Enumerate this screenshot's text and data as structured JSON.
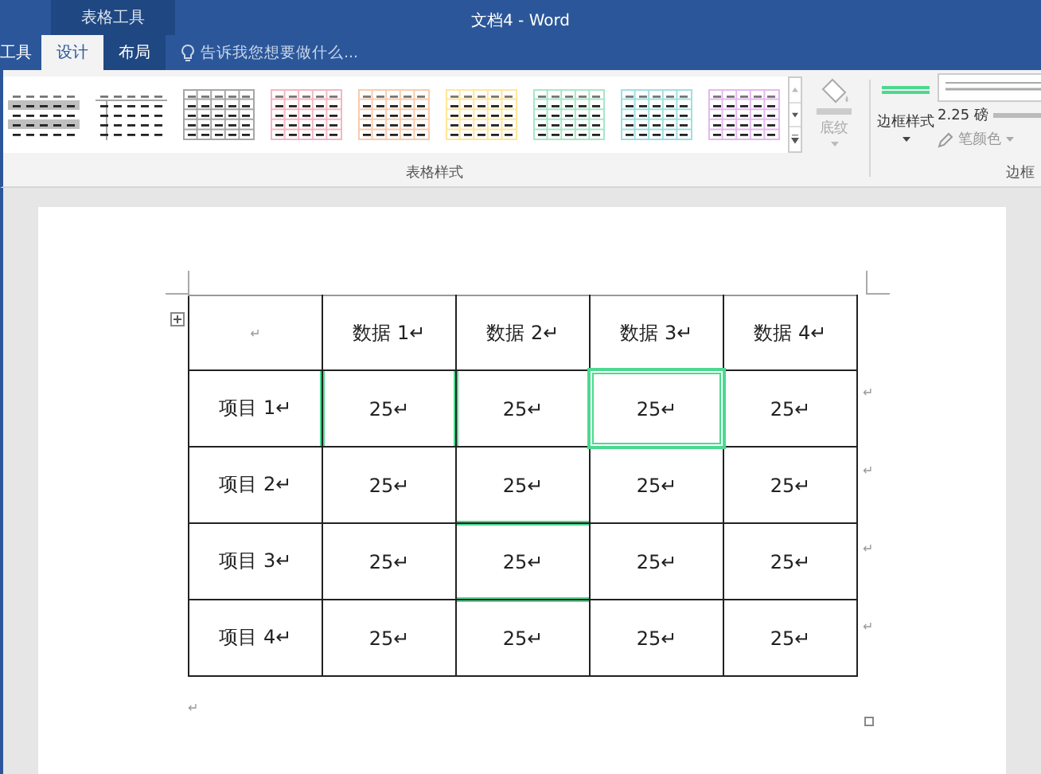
{
  "window": {
    "title": "文档4 - Word",
    "context_group": "表格工具"
  },
  "tabs": [
    {
      "label": "工具",
      "selected": false
    },
    {
      "label": "设计",
      "selected": true
    },
    {
      "label": "布局",
      "selected": false
    }
  ],
  "tell_me": {
    "placeholder": "告诉我您想要做什么..."
  },
  "table_styles": {
    "label": "表格样式",
    "styles": [
      {
        "kind": "banded",
        "color": "#bfbfbf"
      },
      {
        "kind": "lined",
        "color": "#a6a6a6"
      },
      {
        "kind": "grid",
        "color": "#a6a6a6"
      },
      {
        "kind": "grid",
        "color": "#f4b6c2"
      },
      {
        "kind": "grid",
        "color": "#f8cbad"
      },
      {
        "kind": "grid",
        "color": "#ffe699"
      },
      {
        "kind": "grid",
        "color": "#a9e5c8"
      },
      {
        "kind": "grid",
        "color": "#9fdfe0"
      },
      {
        "kind": "grid",
        "color": "#e4b8f0"
      }
    ]
  },
  "shading": {
    "label": "底纹",
    "disabled": true
  },
  "borders": {
    "label": "边框",
    "style_button": "边框样式",
    "weight": "2.25 磅",
    "pen_color": "笔颜色"
  },
  "table": {
    "rows": [
      [
        {
          "text": "↵",
          "right_border_highlighted": false,
          "bottom_border_highlighted": false,
          "selected": false
        },
        {
          "text": "数据 1↵",
          "right_border_highlighted": false,
          "bottom_border_highlighted": false,
          "selected": false
        },
        {
          "text": "数据 2↵",
          "right_border_highlighted": false,
          "bottom_border_highlighted": false,
          "selected": false
        },
        {
          "text": "数据 3↵",
          "right_border_highlighted": false,
          "bottom_border_highlighted": false,
          "selected": false
        },
        {
          "text": "数据 4↵",
          "right_border_highlighted": false,
          "bottom_border_highlighted": false,
          "selected": false
        }
      ],
      [
        {
          "text": "项目 1↵",
          "right_border_highlighted": true,
          "bottom_border_highlighted": false,
          "selected": false
        },
        {
          "text": "25↵",
          "right_border_highlighted": true,
          "bottom_border_highlighted": false,
          "selected": false
        },
        {
          "text": "25↵",
          "right_border_highlighted": false,
          "bottom_border_highlighted": false,
          "selected": false
        },
        {
          "text": "25↵",
          "right_border_highlighted": false,
          "bottom_border_highlighted": false,
          "selected": true
        },
        {
          "text": "25↵",
          "right_border_highlighted": false,
          "bottom_border_highlighted": false,
          "selected": false
        }
      ],
      [
        {
          "text": "项目 2↵",
          "right_border_highlighted": false,
          "bottom_border_highlighted": false,
          "selected": false
        },
        {
          "text": "25↵",
          "right_border_highlighted": false,
          "bottom_border_highlighted": false,
          "selected": false
        },
        {
          "text": "25↵",
          "right_border_highlighted": false,
          "bottom_border_highlighted": true,
          "selected": false
        },
        {
          "text": "25↵",
          "right_border_highlighted": false,
          "bottom_border_highlighted": false,
          "selected": false
        },
        {
          "text": "25↵",
          "right_border_highlighted": false,
          "bottom_border_highlighted": false,
          "selected": false
        }
      ],
      [
        {
          "text": "项目 3↵",
          "right_border_highlighted": false,
          "bottom_border_highlighted": false,
          "selected": false
        },
        {
          "text": "25↵",
          "right_border_highlighted": false,
          "bottom_border_highlighted": false,
          "selected": false
        },
        {
          "text": "25↵",
          "right_border_highlighted": false,
          "bottom_border_highlighted": true,
          "selected": false
        },
        {
          "text": "25↵",
          "right_border_highlighted": false,
          "bottom_border_highlighted": false,
          "selected": false
        },
        {
          "text": "25↵",
          "right_border_highlighted": false,
          "bottom_border_highlighted": false,
          "selected": false
        }
      ],
      [
        {
          "text": "项目 4↵",
          "right_border_highlighted": false,
          "bottom_border_highlighted": false,
          "selected": false
        },
        {
          "text": "25↵",
          "right_border_highlighted": false,
          "bottom_border_highlighted": false,
          "selected": false
        },
        {
          "text": "25↵",
          "right_border_highlighted": false,
          "bottom_border_highlighted": false,
          "selected": false
        },
        {
          "text": "25↵",
          "right_border_highlighted": false,
          "bottom_border_highlighted": false,
          "selected": false
        },
        {
          "text": "25↵",
          "right_border_highlighted": false,
          "bottom_border_highlighted": false,
          "selected": false
        }
      ]
    ],
    "row_marks": [
      "↵",
      "↵",
      "↵",
      "↵"
    ],
    "after_mark": "↵"
  }
}
